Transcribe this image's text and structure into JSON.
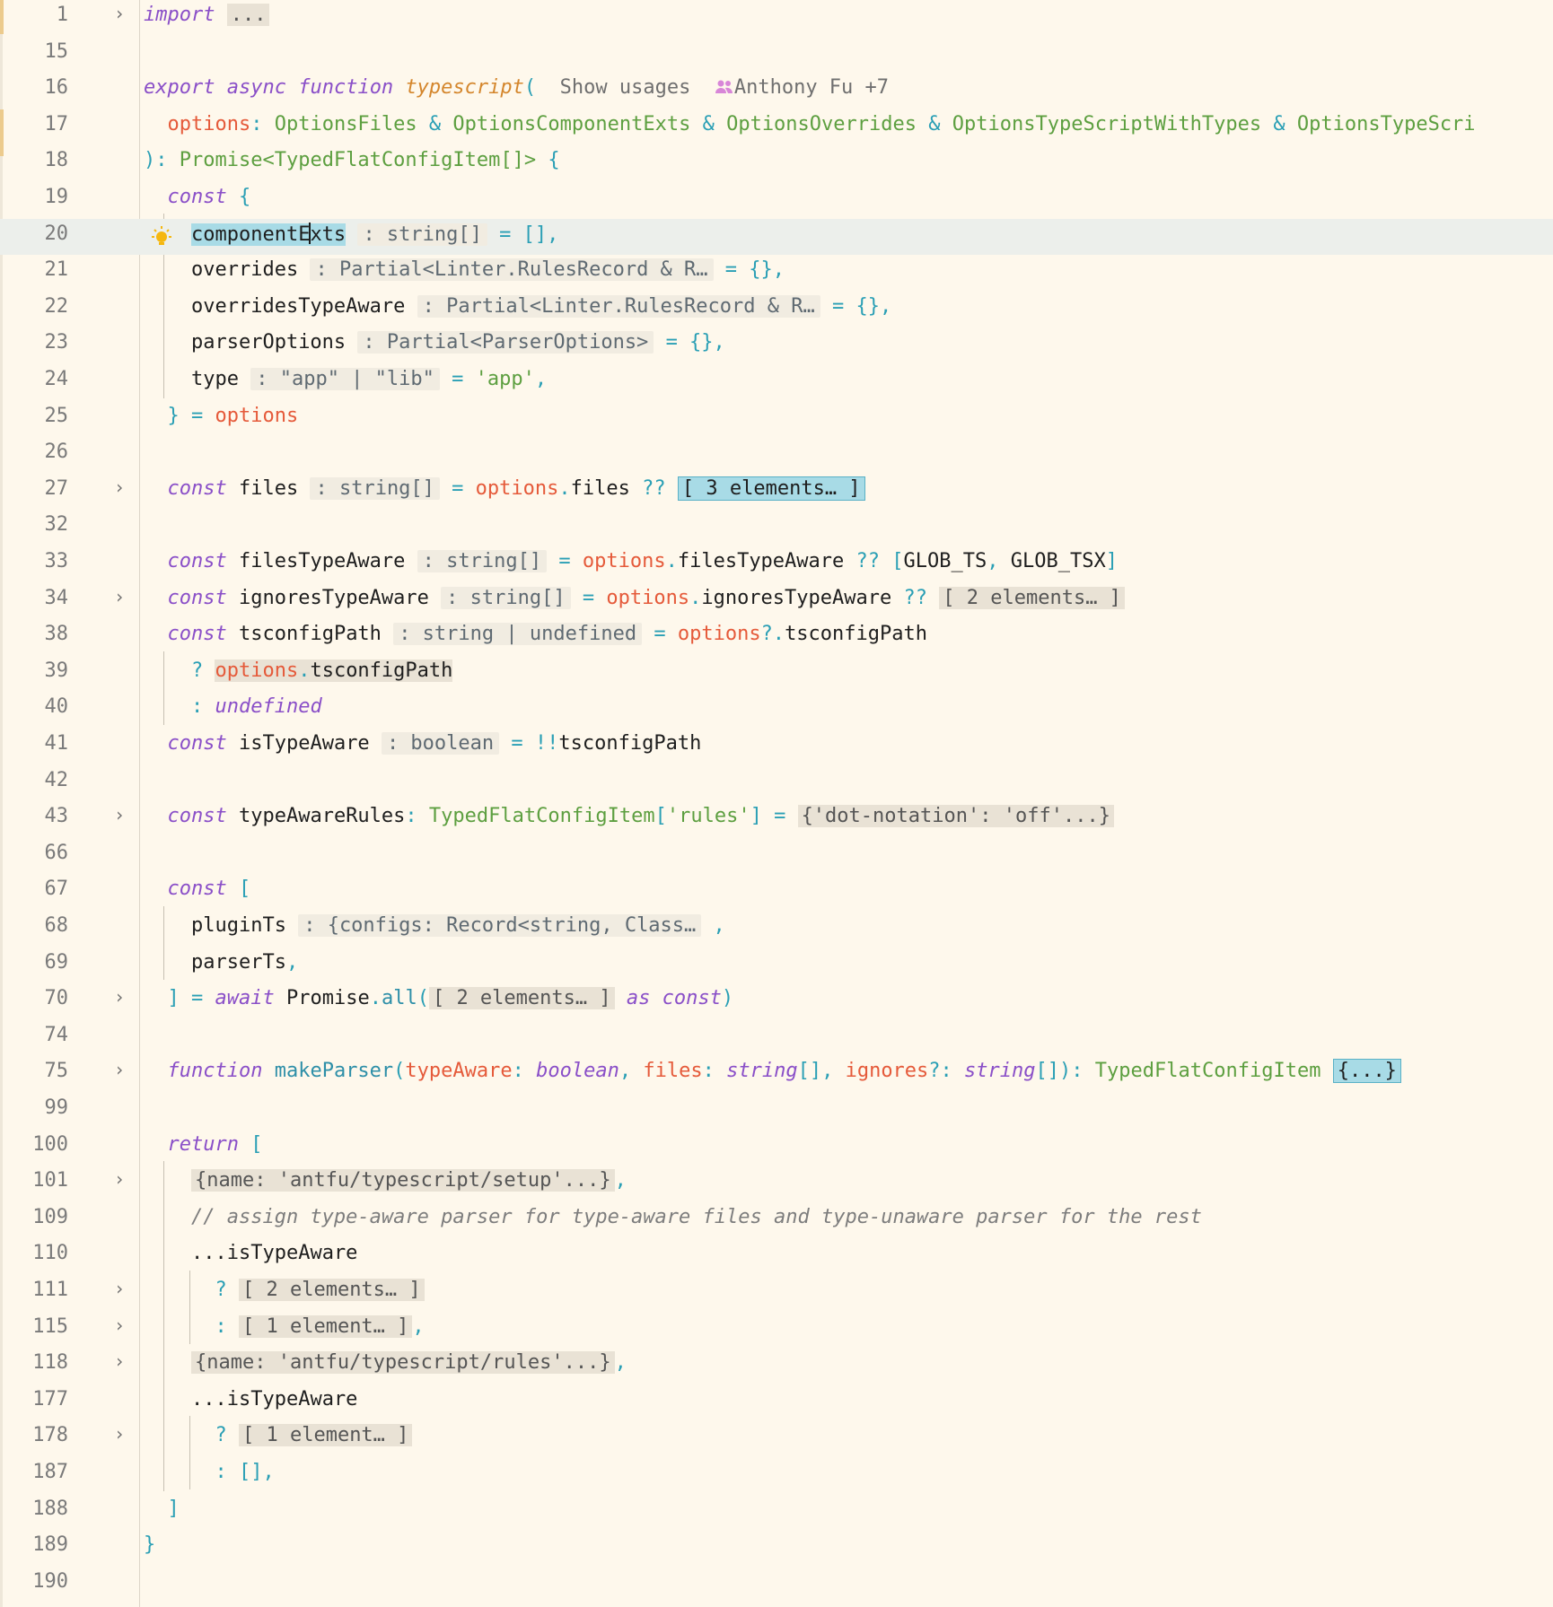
{
  "editor": {
    "show_usages": "Show usages",
    "author": "Anthony Fu +7"
  },
  "lines": [
    {
      "n": "1"
    },
    {
      "n": "15"
    },
    {
      "n": "16"
    },
    {
      "n": "17"
    },
    {
      "n": "18"
    },
    {
      "n": "19"
    },
    {
      "n": "20"
    },
    {
      "n": "21"
    },
    {
      "n": "22"
    },
    {
      "n": "23"
    },
    {
      "n": "24"
    },
    {
      "n": "25"
    },
    {
      "n": "26"
    },
    {
      "n": "27"
    },
    {
      "n": "32"
    },
    {
      "n": "33"
    },
    {
      "n": "34"
    },
    {
      "n": "38"
    },
    {
      "n": "39"
    },
    {
      "n": "40"
    },
    {
      "n": "41"
    },
    {
      "n": "42"
    },
    {
      "n": "43"
    },
    {
      "n": "66"
    },
    {
      "n": "67"
    },
    {
      "n": "68"
    },
    {
      "n": "69"
    },
    {
      "n": "70"
    },
    {
      "n": "74"
    },
    {
      "n": "75"
    },
    {
      "n": "99"
    },
    {
      "n": "100"
    },
    {
      "n": "101"
    },
    {
      "n": "109"
    },
    {
      "n": "110"
    },
    {
      "n": "111"
    },
    {
      "n": "115"
    },
    {
      "n": "118"
    },
    {
      "n": "177"
    },
    {
      "n": "178"
    },
    {
      "n": "187"
    },
    {
      "n": "188"
    },
    {
      "n": "189"
    },
    {
      "n": "190"
    }
  ],
  "code": {
    "l1_kw": "import",
    "l1_fold": "...",
    "l16_export": "export",
    "l16_async": "async",
    "l16_function": "function",
    "l16_name": "typescript",
    "l16_paren": "(",
    "l17_param": "options",
    "l17_colon": ":",
    "l17_t1": "OptionsFiles",
    "l17_t2": "OptionsComponentExts",
    "l17_t3": "OptionsOverrides",
    "l17_t4": "OptionsTypeScriptWithTypes",
    "l17_t5": "OptionsTypeScri",
    "amp": "&",
    "l18_open": "): ",
    "l18_type": "Promise<TypedFlatConfigItem[]>",
    "l18_brace": " {",
    "const": "const",
    "open_brace": "{",
    "l20_ident_a": "componentE",
    "l20_ident_b": "xts",
    "l20_hint": ": string[]",
    "l20_val": "= [],",
    "l21_ident": "overrides",
    "l21_hint": ": Partial<Linter.RulesRecord & R…",
    "l21_val": "= {},",
    "l22_ident": "overridesTypeAware",
    "l22_hint": ": Partial<Linter.RulesRecord & R…",
    "l22_val": "= {},",
    "l23_ident": "parserOptions",
    "l23_hint": ": Partial<ParserOptions>",
    "l23_val": "= {},",
    "l24_ident": "type",
    "l24_hint": ": \"app\" | \"lib\"",
    "l24_eq": "=",
    "l24_str": "'app'",
    "comma": ",",
    "l25_close": "} =",
    "l25_opts": "options",
    "l27_ident": "files",
    "l27_hint": ": string[]",
    "eq": "=",
    "options": "options",
    "dot": ".",
    "l27_prop": "files",
    "nullish": "??",
    "l27_fold": "[ 3 elements… ]",
    "l33_ident": "filesTypeAware",
    "l33_hint": ": string[]",
    "l33_prop": "filesTypeAware",
    "l33_lb": "[",
    "l33_g1": "GLOB_TS",
    "l33_g2": "GLOB_TSX",
    "l33_rb": "]",
    "l34_ident": "ignoresTypeAware",
    "l34_hint": ": string[]",
    "l34_prop": "ignoresTypeAware",
    "l34_fold": "[ 2 elements… ]",
    "l38_ident": "tsconfigPath",
    "l38_hint": ": string | undefined",
    "l38_optdot": "?.",
    "l38_prop": "tsconfigPath",
    "q": "?",
    "l39_prop": "tsconfigPath",
    "colon": ":",
    "l40_undef": "undefined",
    "l41_ident": "isTypeAware",
    "l41_hint": ": boolean",
    "l41_bang": "!!",
    "l41_val": "tsconfigPath",
    "l43_ident": "typeAwareRules",
    "l43_type": "TypedFlatConfigItem",
    "l43_lb": "[",
    "l43_str": "'rules'",
    "l43_rb": "]",
    "l43_fold": "{'dot-notation': 'off'...}",
    "l67_lb": "[",
    "l68_ident": "pluginTs",
    "l68_hint": ": {configs: Record<string, Class…",
    "l69_ident": "parserTs",
    "l70_rb": "]",
    "await": "await",
    "l70_promise": "Promise",
    "l70_all": "all",
    "l70_lp": "(",
    "l70_fold": "[ 2 elements… ]",
    "as": "as",
    "l70_rp": ")",
    "function": "function",
    "l75_name": "makeParser",
    "l75_lp": "(",
    "l75_p1": "typeAware",
    "l75_t1": "boolean",
    "l75_p2": "files",
    "l75_t2": "string",
    "brackets": "[]",
    "l75_p3": "ignores",
    "l75_qc": "?:",
    "l75_t3": "string",
    "l75_rp": "): ",
    "l75_rtype": "TypedFlatConfigItem",
    "l75_fold": "{...}",
    "return": "return",
    "l100_lb": "[",
    "l101_fold": "{name: 'antfu/typescript/setup'...}",
    "l109_comment": "// assign type-aware parser for type-aware files and type-unaware parser for the rest",
    "spread": "...",
    "is_type_aware": "isTypeAware",
    "l111_fold": "[ 2 elements… ]",
    "l115_fold": "[ 1 element… ]",
    "l118_fold": "{name: 'antfu/typescript/rules'...}",
    "l178_fold": "[ 1 element… ]",
    "l187_val": "[],",
    "l188_rb": "]",
    "l189_rb": "}"
  }
}
